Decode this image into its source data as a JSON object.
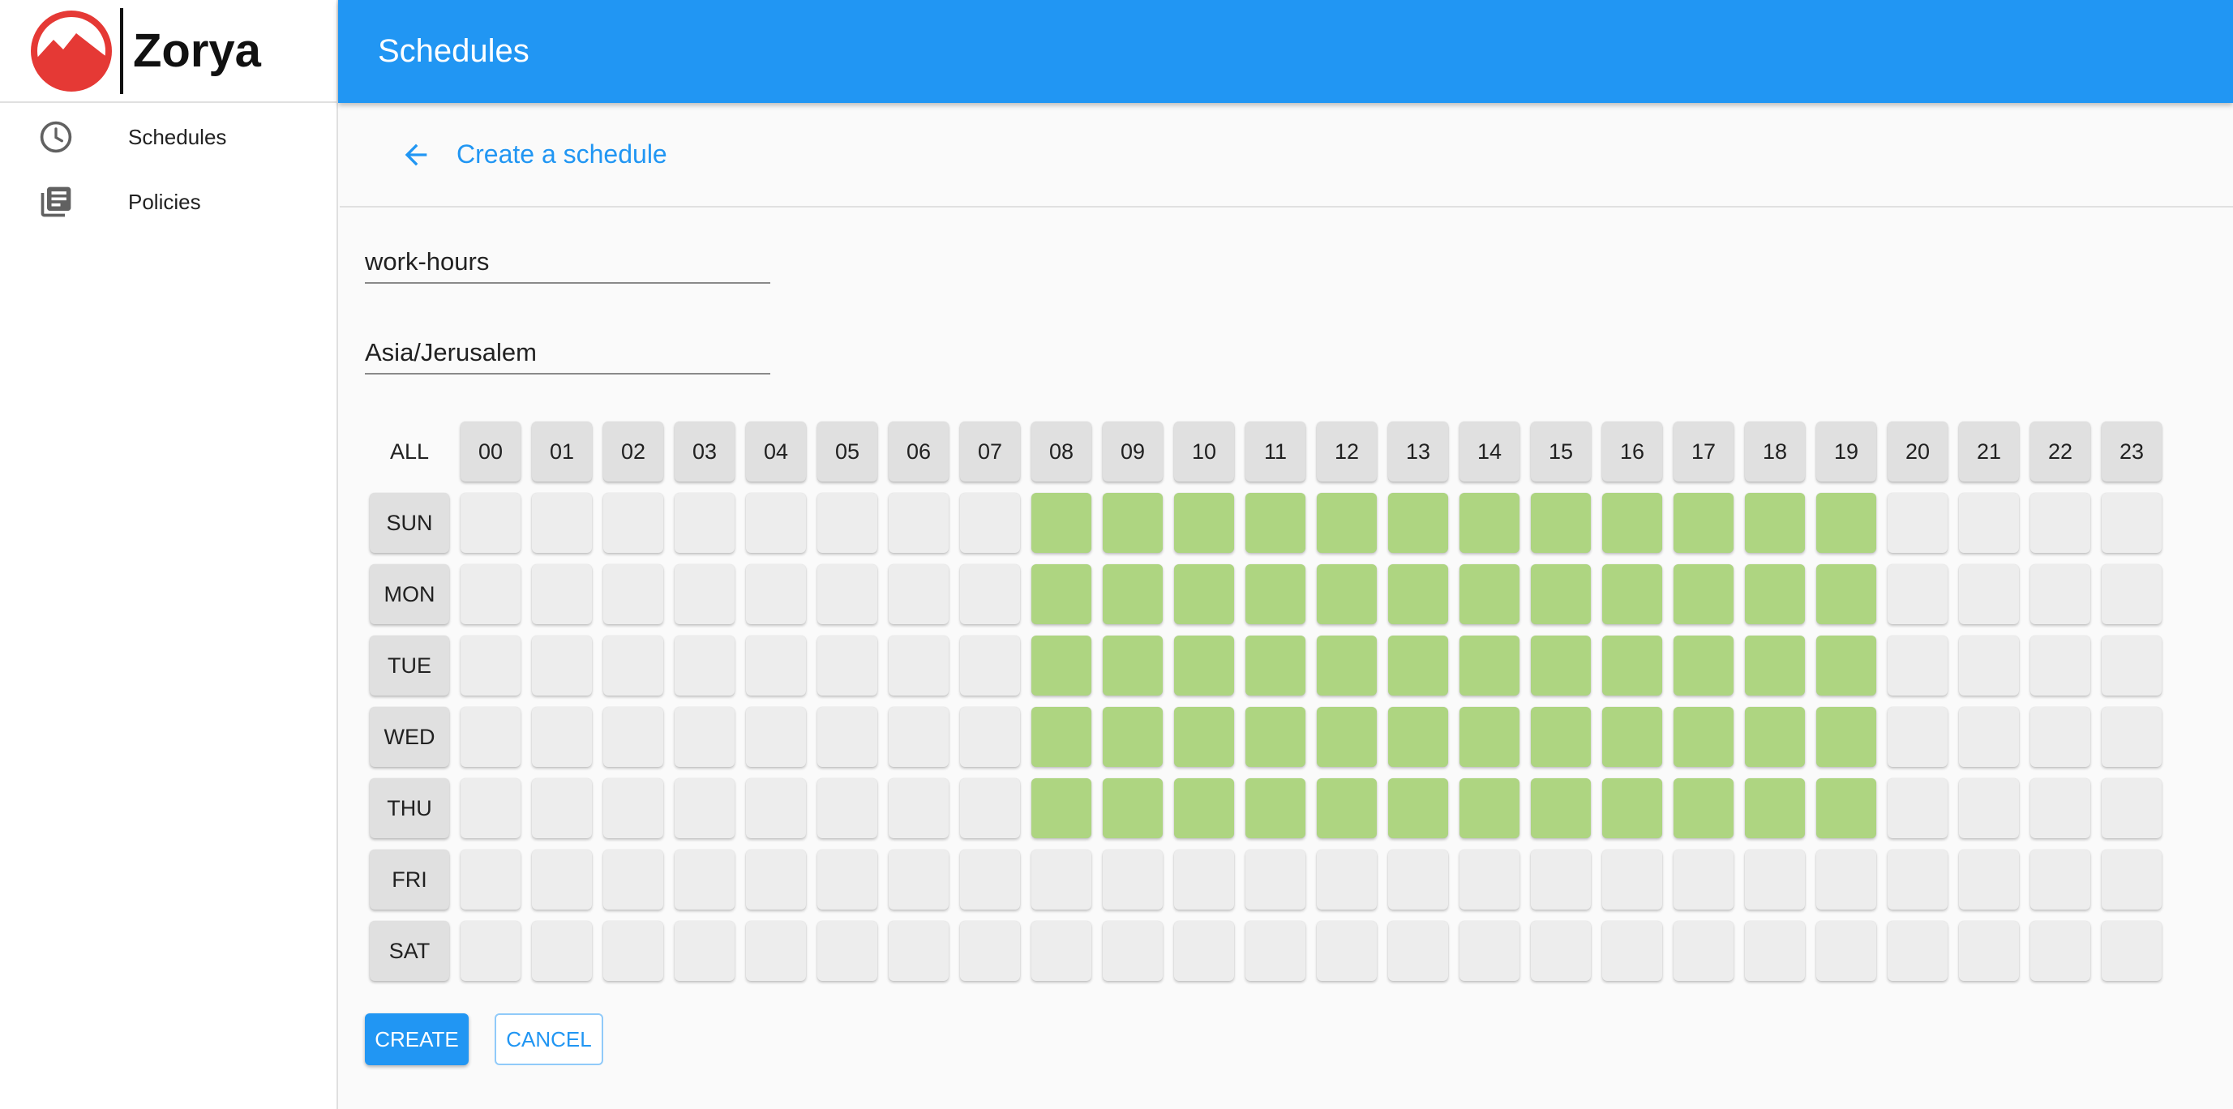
{
  "app": {
    "name": "Zorya"
  },
  "sidebar": {
    "items": [
      {
        "label": "Schedules",
        "icon": "clock-icon"
      },
      {
        "label": "Policies",
        "icon": "library-books-icon"
      }
    ]
  },
  "topbar": {
    "title": "Schedules"
  },
  "subheader": {
    "title": "Create a schedule"
  },
  "form": {
    "name_value": "work-hours",
    "timezone_value": "Asia/Jerusalem"
  },
  "grid": {
    "all_label": "ALL",
    "hours": [
      "00",
      "01",
      "02",
      "03",
      "04",
      "05",
      "06",
      "07",
      "08",
      "09",
      "10",
      "11",
      "12",
      "13",
      "14",
      "15",
      "16",
      "17",
      "18",
      "19",
      "20",
      "21",
      "22",
      "23"
    ],
    "days": [
      "SUN",
      "MON",
      "TUE",
      "WED",
      "THU",
      "FRI",
      "SAT"
    ],
    "active": [
      [
        0,
        0,
        0,
        0,
        0,
        0,
        0,
        0,
        1,
        1,
        1,
        1,
        1,
        1,
        1,
        1,
        1,
        1,
        1,
        1,
        0,
        0,
        0,
        0
      ],
      [
        0,
        0,
        0,
        0,
        0,
        0,
        0,
        0,
        1,
        1,
        1,
        1,
        1,
        1,
        1,
        1,
        1,
        1,
        1,
        1,
        0,
        0,
        0,
        0
      ],
      [
        0,
        0,
        0,
        0,
        0,
        0,
        0,
        0,
        1,
        1,
        1,
        1,
        1,
        1,
        1,
        1,
        1,
        1,
        1,
        1,
        0,
        0,
        0,
        0
      ],
      [
        0,
        0,
        0,
        0,
        0,
        0,
        0,
        0,
        1,
        1,
        1,
        1,
        1,
        1,
        1,
        1,
        1,
        1,
        1,
        1,
        0,
        0,
        0,
        0
      ],
      [
        0,
        0,
        0,
        0,
        0,
        0,
        0,
        0,
        1,
        1,
        1,
        1,
        1,
        1,
        1,
        1,
        1,
        1,
        1,
        1,
        0,
        0,
        0,
        0
      ],
      [
        0,
        0,
        0,
        0,
        0,
        0,
        0,
        0,
        0,
        0,
        0,
        0,
        0,
        0,
        0,
        0,
        0,
        0,
        0,
        0,
        0,
        0,
        0,
        0
      ],
      [
        0,
        0,
        0,
        0,
        0,
        0,
        0,
        0,
        0,
        0,
        0,
        0,
        0,
        0,
        0,
        0,
        0,
        0,
        0,
        0,
        0,
        0,
        0,
        0
      ]
    ]
  },
  "actions": {
    "create_label": "CREATE",
    "cancel_label": "CANCEL"
  },
  "colors": {
    "primary": "#2196f3",
    "active_cell": "#aed581",
    "inactive_cell": "#ededed"
  }
}
